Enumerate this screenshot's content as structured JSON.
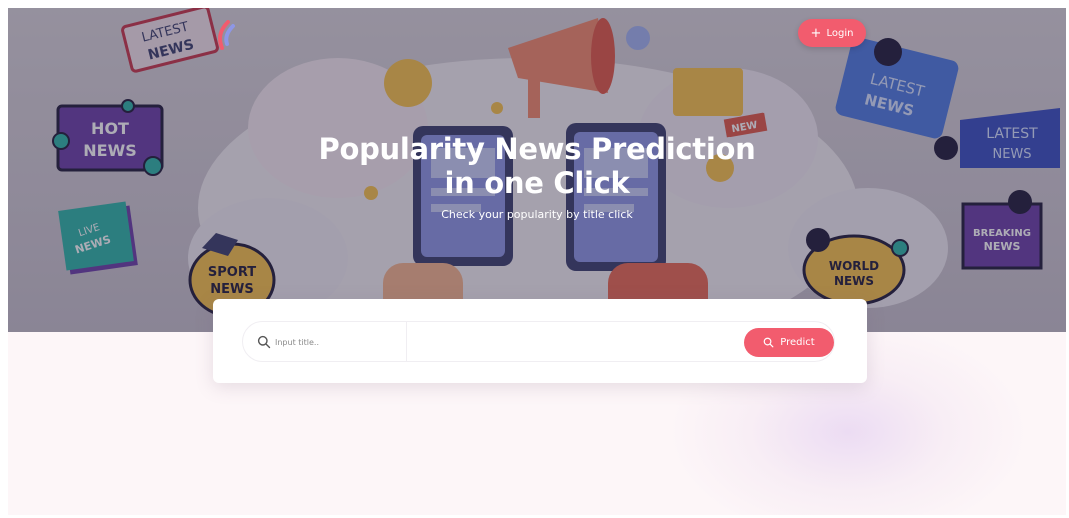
{
  "hero": {
    "title_line1": "Popularity News Prediction",
    "title_line2": "in one Click",
    "subtitle": "Check your popularity by title click"
  },
  "header": {
    "login_label": "Login"
  },
  "stickers": {
    "latest_news_top_left": "LATEST NEWS",
    "hot_news": "HOT NEWS",
    "live_news": "LIVE NEWS",
    "sport_news": "SPORT NEWS",
    "new_badge": "NEW",
    "latest_news_right_1": "LATEST NEWS",
    "latest_news_right_2": "LATEST NEWS",
    "breaking_news": "BREAKING NEWS",
    "world_news": "WORLD NEWS"
  },
  "search": {
    "placeholder": "Input title..",
    "value": "",
    "predict_label": "Predict"
  },
  "colors": {
    "accent": "#f25c6e",
    "overlay": "#28243c",
    "card": "#ffffff"
  }
}
